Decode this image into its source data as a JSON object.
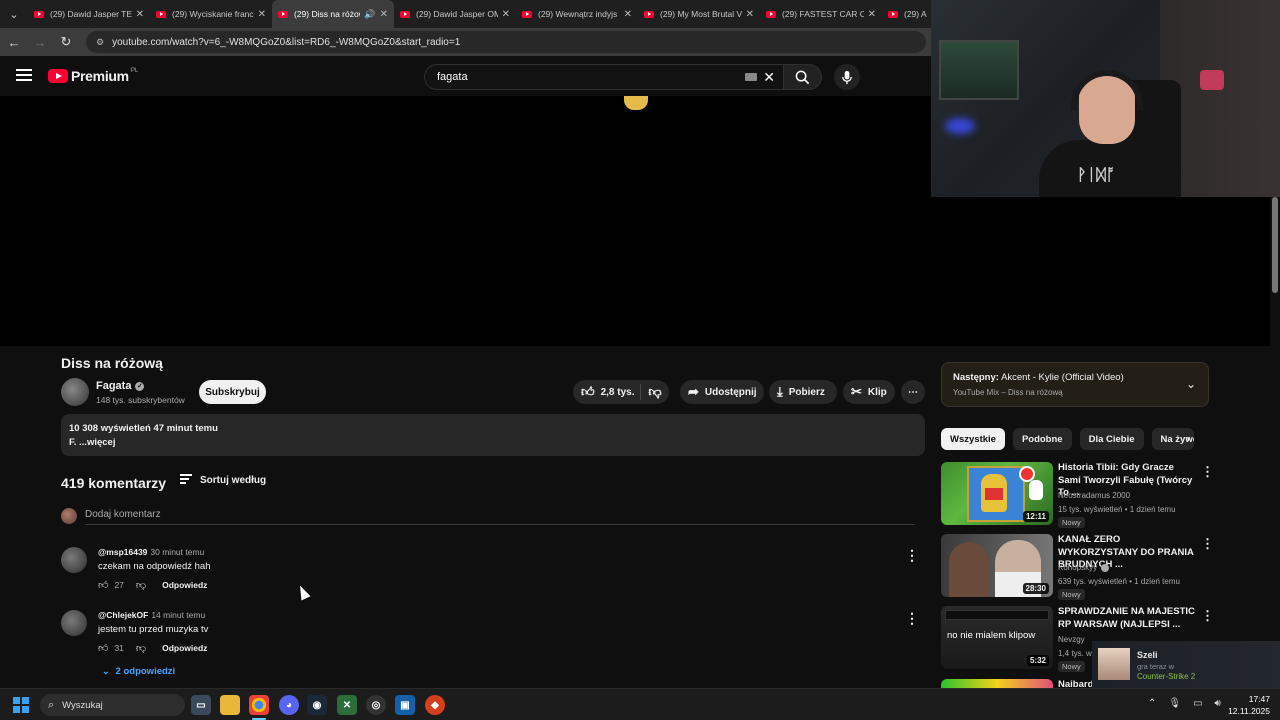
{
  "browser": {
    "tabs": [
      {
        "title": "(29) Dawid Jasper TE",
        "active": false
      },
      {
        "title": "(29) Wyciskanie franc",
        "active": false
      },
      {
        "title": "(29) Diss na różow",
        "active": true
      },
      {
        "title": "(29) Dawid Jasper OM",
        "active": false
      },
      {
        "title": "(29) Wewnątrz indyjs",
        "active": false
      },
      {
        "title": "(29) My Most Brutal V",
        "active": false
      },
      {
        "title": "(29) FASTEST CAR OF",
        "active": false
      },
      {
        "title": "(29) A",
        "active": false
      }
    ],
    "url": "youtube.com/watch?v=6_-W8MQGoZ0&list=RD6_-W8MQGoZ0&start_radio=1"
  },
  "header": {
    "logo_text": "Premium",
    "region": "PL",
    "search_value": "fagata"
  },
  "video": {
    "title": "Diss na różową",
    "channel": "Fagata",
    "subscribers": "148 tys. subskrybentów",
    "subscribe_label": "Subskrybuj",
    "likes": "2,8 tys.",
    "share_label": "Udostępnij",
    "download_label": "Pobierz",
    "clip_label": "Klip",
    "views_time": "10 308 wyświetleń  47 minut temu",
    "description": "F. ...więcej"
  },
  "comments": {
    "count_label": "419 komentarzy",
    "sort_label": "Sortuj według",
    "add_placeholder": "Dodaj komentarz",
    "reply_label": "Odpowiedz",
    "items": [
      {
        "author": "@msp16439",
        "time": "30 minut temu",
        "text": "czekam na odpowiedź hah",
        "likes": "27"
      },
      {
        "author": "@ChlejekOF",
        "time": "14 minut temu",
        "text": "jestem tu przed muzyka tv",
        "likes": "31"
      }
    ],
    "replies_label": "2 odpowiedzi"
  },
  "sidebar": {
    "upnext_prefix": "Następny:",
    "upnext_title": "Akcent - Kylie (Official Video)",
    "upnext_sub": "YouTube Mix – Diss na różową",
    "chips": [
      "Wszystkie",
      "Podobne",
      "Dla Ciebie",
      "Na żywo"
    ],
    "recs": [
      {
        "title": "Historia Tibii: Gdy Gracze Sami Tworzyli Fabułę (Twórcy To ...",
        "channel": "Neostradamus 2000",
        "stats": "15 tys. wyświetleń • 1 dzień temu",
        "badge": "Nowy",
        "duration": "12:11"
      },
      {
        "title": "KANAŁ ZERO WYKORZYSTANY DO PRANIA BRUDNYCH ...",
        "channel": "Konopskyy",
        "stats": "639 tys. wyświetleń • 1 dzień temu",
        "badge": "Nowy",
        "duration": "28:30"
      },
      {
        "title": "SPRAWDZANIE NA MAJESTIC RP WARSAW (NAJLEPSI ...",
        "channel": "Nevzgy",
        "stats": "1,4 tys. w",
        "badge": "Nowy",
        "duration": "5:32",
        "overlay": "no nie mialem klipow"
      },
      {
        "title": "Naibard"
      }
    ]
  },
  "notification": {
    "name": "Szeli",
    "status": "gra teraz w",
    "game": "Counter-Strike 2"
  },
  "taskbar": {
    "search_placeholder": "Wyszukaj",
    "time": "17:47",
    "date": "12.11.2025"
  }
}
